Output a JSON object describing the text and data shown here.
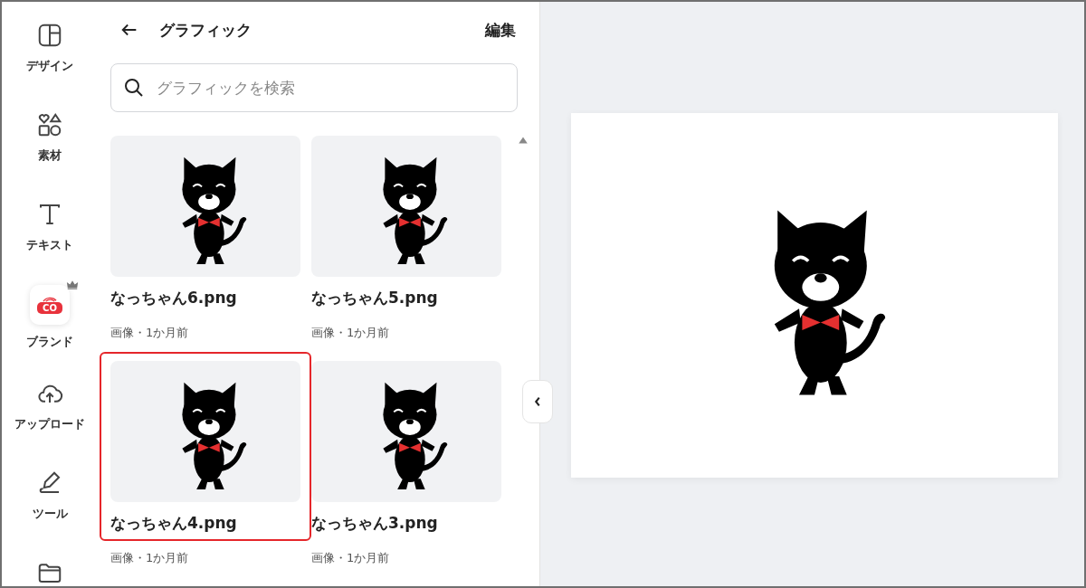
{
  "sidebar": {
    "items": [
      {
        "kind": "design",
        "label": "デザイン"
      },
      {
        "kind": "elements",
        "label": "素材"
      },
      {
        "kind": "text",
        "label": "テキスト"
      },
      {
        "kind": "brand",
        "label": "ブランド",
        "logo_text": "CO"
      },
      {
        "kind": "upload",
        "label": "アップロード"
      },
      {
        "kind": "tools",
        "label": "ツール"
      },
      {
        "kind": "folder"
      }
    ]
  },
  "panel": {
    "title": "グラフィック",
    "edit_link": "編集",
    "search": {
      "placeholder": "グラフィックを検索"
    },
    "cards": [
      {
        "name": "なっちゃん6.png",
        "meta": "画像・1か月前",
        "selected": false
      },
      {
        "name": "なっちゃん5.png",
        "meta": "画像・1か月前",
        "selected": false
      },
      {
        "name": "なっちゃん4.png",
        "meta": "画像・1か月前",
        "selected": true
      },
      {
        "name": "なっちゃん3.png",
        "meta": "画像・1か月前",
        "selected": false
      }
    ]
  }
}
